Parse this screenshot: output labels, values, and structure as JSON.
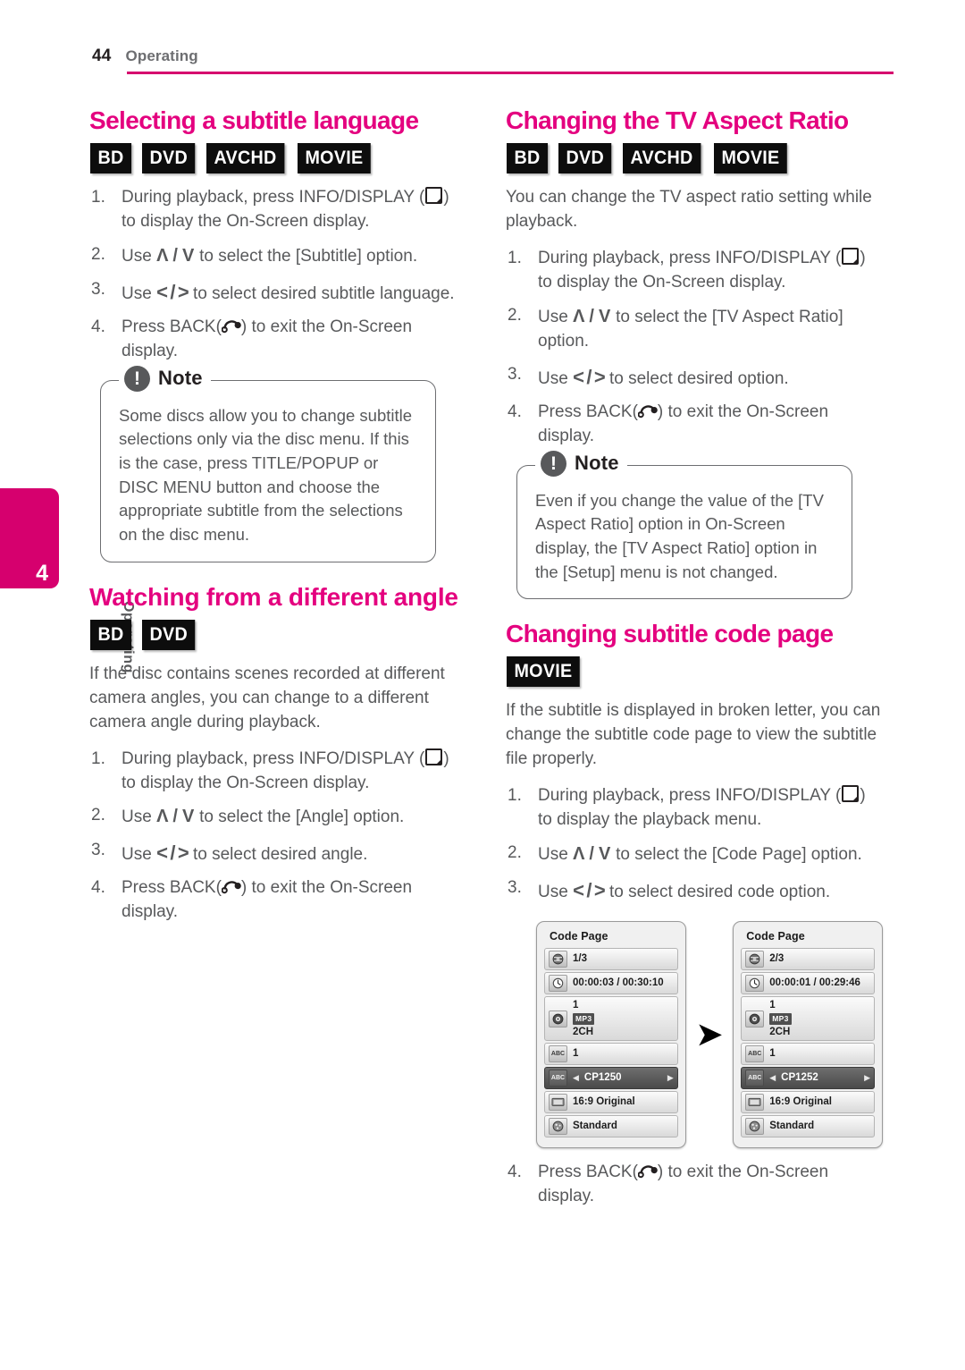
{
  "header": {
    "page_number": "44",
    "section": "Operating",
    "rule_color": "#d6006e"
  },
  "side_tab": {
    "chapter_number": "4",
    "chapter_label": "Operating",
    "color": "#d6006e"
  },
  "colors": {
    "heading_magenta": "#e4007f",
    "body_gray": "#58595b",
    "badge_black": "#0d0d0d"
  },
  "left_column": {
    "section1": {
      "title": "Selecting a subtitle language",
      "badges": [
        "BD",
        "DVD",
        "AVCHD",
        "MOVIE"
      ],
      "steps": [
        {
          "num": "1.",
          "pre": "During playback, press INFO/DISPLAY (",
          "icon": "display-key-icon",
          "post": ") to display the On-Screen display."
        },
        {
          "num": "2.",
          "pre": "Use ",
          "icon": "up-down-arrows",
          "post": " to select the [Subtitle] option."
        },
        {
          "num": "3.",
          "pre": "Use ",
          "icon": "left-right-arrows",
          "post": " to select desired subtitle language."
        },
        {
          "num": "4.",
          "pre": "Press BACK(",
          "icon": "back-key-icon",
          "post": ") to exit the On-Screen display."
        }
      ],
      "note": {
        "title": "Note",
        "body": "Some discs allow you to change subtitle selections only via the disc menu. If this is the case, press TITLE/POPUP or DISC MENU button and choose the appropriate subtitle from the selections on the disc menu."
      }
    },
    "section2": {
      "title": "Watching from a different angle",
      "badges": [
        "BD",
        "DVD"
      ],
      "intro": "If the disc contains scenes recorded at different camera angles, you can change to a different camera angle during playback.",
      "steps": [
        {
          "num": "1.",
          "pre": "During playback, press INFO/DISPLAY (",
          "icon": "display-key-icon",
          "post": ") to display the On-Screen display."
        },
        {
          "num": "2.",
          "pre": "Use ",
          "icon": "up-down-arrows",
          "post": " to select the [Angle] option."
        },
        {
          "num": "3.",
          "pre": "Use ",
          "icon": "left-right-arrows",
          "post": " to select desired angle."
        },
        {
          "num": "4.",
          "pre": "Press BACK(",
          "icon": "back-key-icon",
          "post": ") to exit the On-Screen display."
        }
      ]
    }
  },
  "right_column": {
    "section1": {
      "title": "Changing the TV Aspect Ratio",
      "badges": [
        "BD",
        "DVD",
        "AVCHD",
        "MOVIE"
      ],
      "intro": "You can change the TV aspect ratio setting while playback.",
      "steps": [
        {
          "num": "1.",
          "pre": "During playback, press INFO/DISPLAY (",
          "icon": "display-key-icon",
          "post": ") to display the On-Screen display."
        },
        {
          "num": "2.",
          "pre": "Use ",
          "icon": "up-down-arrows",
          "post": " to select the [TV Aspect Ratio] option."
        },
        {
          "num": "3.",
          "pre": "Use ",
          "icon": "left-right-arrows",
          "post": " to select desired option."
        },
        {
          "num": "4.",
          "pre": "Press BACK(",
          "icon": "back-key-icon",
          "post": ") to exit the On-Screen display."
        }
      ],
      "note": {
        "title": "Note",
        "body": "Even if you change the value of the [TV Aspect Ratio] option in On-Screen display, the [TV Aspect Ratio] option in the [Setup] menu is not changed."
      }
    },
    "section2": {
      "title": "Changing subtitle code page",
      "badges": [
        "MOVIE"
      ],
      "intro": "If the subtitle is displayed in broken letter, you can change the subtitle code page to view the subtitle file properly.",
      "steps": [
        {
          "num": "1.",
          "pre": "During playback, press INFO/DISPLAY (",
          "icon": "display-key-icon",
          "post": ") to display the playback menu."
        },
        {
          "num": "2.",
          "pre": "Use ",
          "icon": "up-down-arrows",
          "post": " to select the [Code Page] option."
        },
        {
          "num": "3.",
          "pre": "Use ",
          "icon": "left-right-arrows",
          "post": " to select desired code option."
        }
      ],
      "final_step": {
        "num": "4.",
        "pre": "Press BACK(",
        "icon": "back-key-icon",
        "post": ") to exit the On-Screen display."
      },
      "figure": {
        "arrow": "➤",
        "panels": [
          {
            "title": "Code Page",
            "rows": [
              {
                "icon": "title-disc-icon",
                "icon_label": "",
                "text": "1/3",
                "selected": false
              },
              {
                "icon": "clock-icon",
                "icon_label": "",
                "text": "00:00:03 / 00:30:10",
                "selected": false
              },
              {
                "icon": "audio-disc-icon",
                "icon_label": "",
                "line1": "1",
                "badge": "MP3",
                "line3": "2CH",
                "selected": false
              },
              {
                "icon": "subtitle-abc-icon",
                "icon_label": "ABC",
                "text": "1",
                "selected": false
              },
              {
                "icon": "code-page-icon",
                "icon_label": "ABC",
                "text": "CP1250",
                "selected": true,
                "left_arrow": "◀",
                "right_arrow": "▶"
              },
              {
                "icon": "tv-aspect-icon",
                "icon_label": "",
                "text": "16:9 Original",
                "selected": false
              },
              {
                "icon": "picture-mode-icon",
                "icon_label": "",
                "text": "Standard",
                "selected": false
              }
            ]
          },
          {
            "title": "Code Page",
            "rows": [
              {
                "icon": "title-disc-icon",
                "icon_label": "",
                "text": "2/3",
                "selected": false
              },
              {
                "icon": "clock-icon",
                "icon_label": "",
                "text": "00:00:01 / 00:29:46",
                "selected": false
              },
              {
                "icon": "audio-disc-icon",
                "icon_label": "",
                "line1": "1",
                "badge": "MP3",
                "line3": "2CH",
                "selected": false
              },
              {
                "icon": "subtitle-abc-icon",
                "icon_label": "ABC",
                "text": "1",
                "selected": false
              },
              {
                "icon": "code-page-icon",
                "icon_label": "ABC",
                "text": "CP1252",
                "selected": true,
                "left_arrow": "◀",
                "right_arrow": "▶"
              },
              {
                "icon": "tv-aspect-icon",
                "icon_label": "",
                "text": "16:9 Original",
                "selected": false
              },
              {
                "icon": "picture-mode-icon",
                "icon_label": "",
                "text": "Standard",
                "selected": false
              }
            ]
          }
        ]
      }
    }
  }
}
